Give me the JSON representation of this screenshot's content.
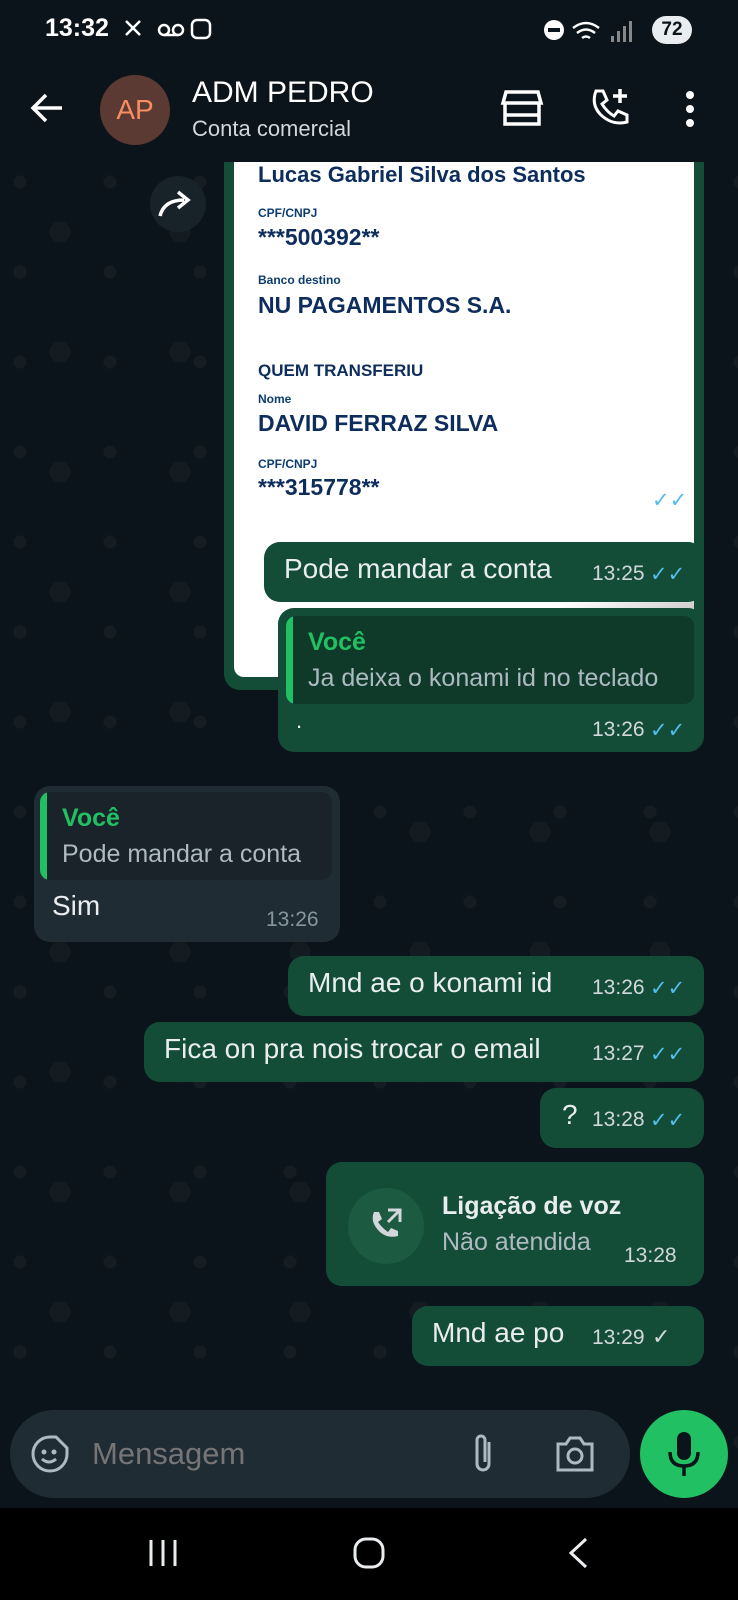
{
  "status_bar": {
    "time": "13:32",
    "battery": "72"
  },
  "header": {
    "avatar_initials": "AP",
    "title": "ADM PEDRO",
    "subtitle": "Conta comercial"
  },
  "receipt": {
    "partial_name": "Lucas Gabriel Silva dos Santos",
    "cpf_label_1": "CPF/CNPJ",
    "cpf_value_1": "***500392**",
    "bank_label": "Banco destino",
    "bank_value": "NU PAGAMENTOS S.A.",
    "section_title": "QUEM TRANSFERIU",
    "name_label": "Nome",
    "name_value": "DAVID FERRAZ SILVA",
    "cpf_label_2": "CPF/CNPJ",
    "cpf_value_2": "***315778**",
    "time": "13:25"
  },
  "messages": [
    {
      "text": "Pode mandar a conta",
      "time": "13:25"
    },
    {
      "quote_author": "Você",
      "quote_text": "Ja deixa o konami id no teclado",
      "text": ".",
      "time": "13:26"
    },
    {
      "quote_author": "Você",
      "quote_text": "Pode mandar a conta",
      "text": "Sim",
      "time": "13:26"
    },
    {
      "text": "Mnd ae o konami id",
      "time": "13:26"
    },
    {
      "text": "Fica on pra nois trocar o email",
      "time": "13:27"
    },
    {
      "text": "?",
      "time": "13:28"
    },
    {
      "call_title": "Ligação de voz",
      "call_status": "Não atendida",
      "time": "13:28"
    },
    {
      "text": "Mnd ae po",
      "time": "13:29"
    }
  ],
  "input": {
    "placeholder": "Mensagem"
  },
  "colors": {
    "outgoing": "#144d37",
    "incoming": "#202c33",
    "accent": "#21c063",
    "read_ticks": "#53bdeb"
  }
}
